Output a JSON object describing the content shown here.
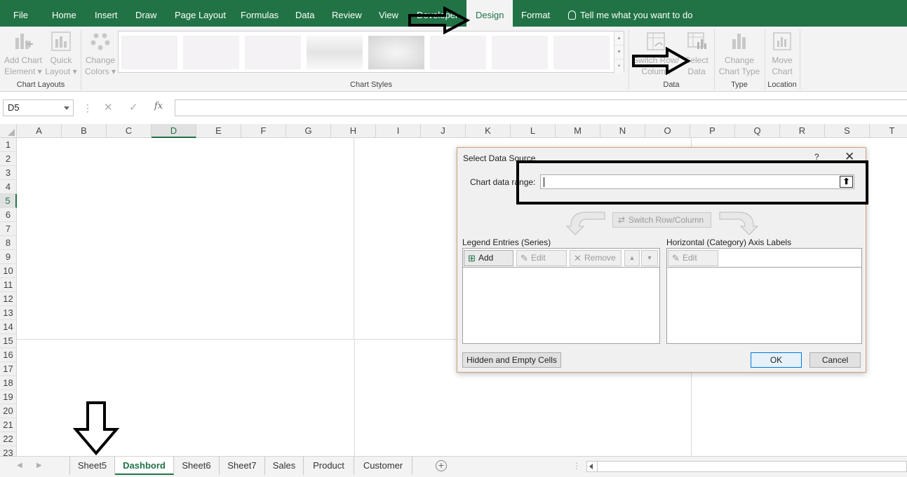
{
  "tabs": [
    {
      "label": "File",
      "active": false
    },
    {
      "label": "Home",
      "active": false
    },
    {
      "label": "Insert",
      "active": false
    },
    {
      "label": "Draw",
      "active": false
    },
    {
      "label": "Page Layout",
      "active": false
    },
    {
      "label": "Formulas",
      "active": false
    },
    {
      "label": "Data",
      "active": false
    },
    {
      "label": "Review",
      "active": false
    },
    {
      "label": "View",
      "active": false
    },
    {
      "label": "Developer",
      "active": false
    },
    {
      "label": "Design",
      "active": true
    },
    {
      "label": "Format",
      "active": false
    }
  ],
  "tell_me": "Tell me what you want to do",
  "ribbon": {
    "add_chart_element": [
      "Add Chart",
      "Element"
    ],
    "quick_layout": [
      "Quick",
      "Layout"
    ],
    "change_colors": [
      "Change",
      "Colors"
    ],
    "switch_row_col": [
      "Switch Row/",
      "Column"
    ],
    "select_data": [
      "Select",
      "Data"
    ],
    "change_chart_type": [
      "Change",
      "Chart Type"
    ],
    "move_chart": [
      "Move",
      "Chart"
    ],
    "groups": {
      "chart_layouts": "Chart Layouts",
      "chart_styles": "Chart Styles",
      "data": "Data",
      "type": "Type",
      "location": "Location"
    }
  },
  "formula_bar": {
    "name_box": "D5",
    "fx": "fx",
    "cancel": "✕",
    "enter": "✓",
    "value": ""
  },
  "columns": [
    "A",
    "B",
    "C",
    "D",
    "E",
    "F",
    "G",
    "H",
    "I",
    "J",
    "K",
    "L",
    "M",
    "N",
    "O",
    "P",
    "Q",
    "R",
    "S",
    "T"
  ],
  "selected_column": "D",
  "rows": [
    "1",
    "2",
    "3",
    "4",
    "5",
    "6",
    "7",
    "8",
    "9",
    "10",
    "11",
    "12",
    "13",
    "14",
    "15",
    "16",
    "17",
    "18",
    "19",
    "20",
    "21",
    "22",
    "23"
  ],
  "selected_row": "5",
  "dialog": {
    "title": "Select Data Source",
    "help": "?",
    "close": "✕",
    "chart_range_label": "Chart data range:",
    "chart_range_value": "",
    "switch_row_col": "Switch Row/Column",
    "legend_label": "Legend Entries (Series)",
    "axis_label": "Horizontal (Category) Axis Labels",
    "add": "Add",
    "edit": "Edit",
    "remove": "Remove",
    "axis_edit": "Edit",
    "hidden_empty": "Hidden and Empty Cells",
    "ok": "OK",
    "cancel": "Cancel"
  },
  "sheets": [
    {
      "label": "Sheet5",
      "active": false
    },
    {
      "label": "Dashbord",
      "active": true
    },
    {
      "label": "Sheet6",
      "active": false
    },
    {
      "label": "Sheet7",
      "active": false
    },
    {
      "label": "Sales",
      "active": false
    },
    {
      "label": "Product",
      "active": false
    },
    {
      "label": "Customer",
      "active": false
    }
  ],
  "colors": {
    "excel_green": "#217346",
    "annotation": "#000000"
  }
}
